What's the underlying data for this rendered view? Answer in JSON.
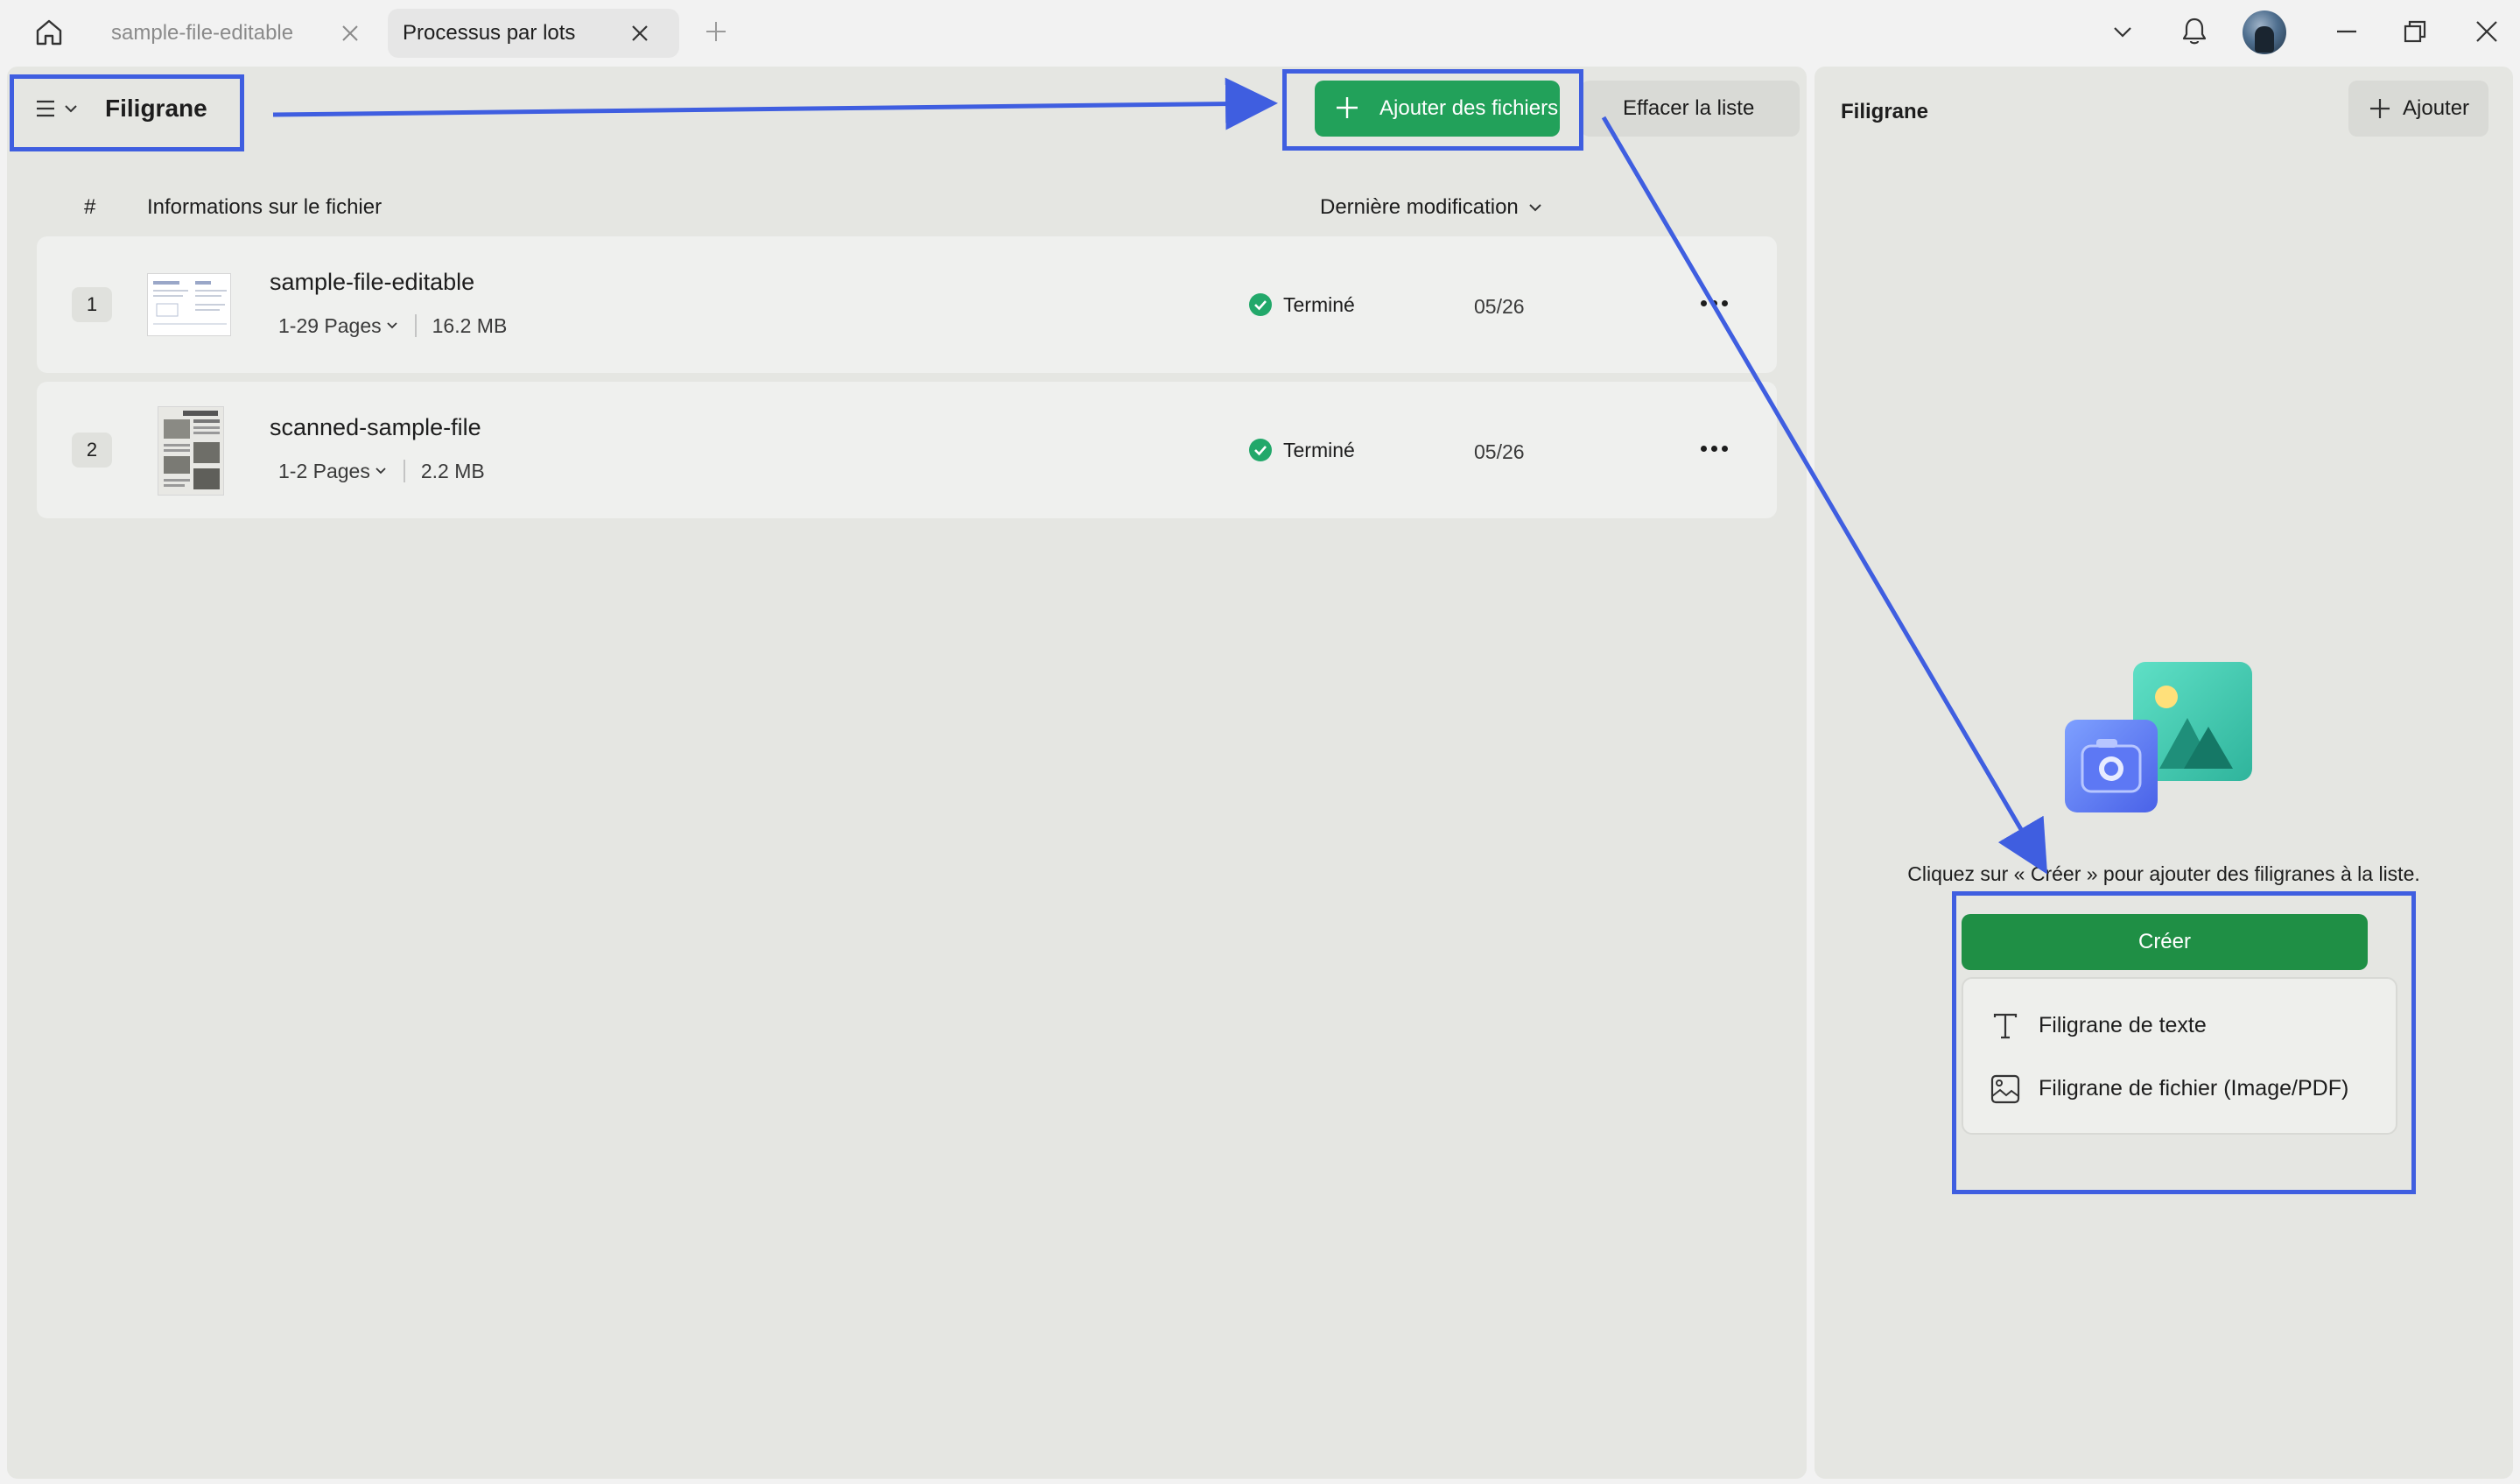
{
  "tabs": [
    {
      "label": "sample-file-editable",
      "active": false
    },
    {
      "label": "Processus par lots",
      "active": true
    }
  ],
  "header": {
    "title": "Filigrane"
  },
  "toolbar": {
    "add_files_label": "Ajouter des fichiers",
    "clear_list_label": "Effacer la liste"
  },
  "table": {
    "col_number": "#",
    "col_info": "Informations sur le fichier",
    "col_modified": "Dernière modification"
  },
  "files": [
    {
      "index": "1",
      "name": "sample-file-editable",
      "pages": "1-29 Pages",
      "size": "16.2 MB",
      "status": "Terminé",
      "date": "05/26"
    },
    {
      "index": "2",
      "name": "scanned-sample-file",
      "pages": "1-2 Pages",
      "size": "2.2 MB",
      "status": "Terminé",
      "date": "05/26"
    }
  ],
  "right_panel": {
    "title": "Filigrane",
    "add_label": "Ajouter",
    "hint": "Cliquez sur « Créer » pour ajouter des filigranes à la liste.",
    "create_label": "Créer",
    "menu": [
      {
        "label": "Filigrane de texte",
        "icon": "text-icon"
      },
      {
        "label": "Filigrane de fichier (Image/PDF)",
        "icon": "image-file-icon"
      }
    ]
  },
  "colors": {
    "accent_green": "#22a15a",
    "create_green": "#1f8f45",
    "highlight_blue": "#3f5ee0",
    "status_green": "#22a86a"
  }
}
